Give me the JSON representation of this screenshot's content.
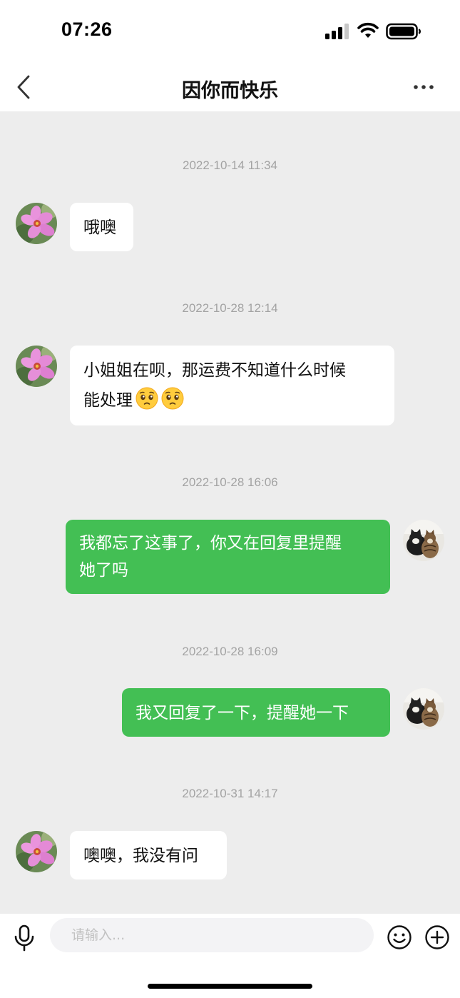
{
  "status_bar": {
    "time": "07:26"
  },
  "header": {
    "title": "因你而快乐"
  },
  "messages": [
    {
      "timestamp": "2022-10-14 11:34",
      "sender": "contact",
      "text": "哦噢"
    },
    {
      "timestamp": "2022-10-28 12:14",
      "sender": "contact",
      "text_line1": "小姐姐在呗，那运费不知道什么时候",
      "text_line2": "能处理",
      "emojis": [
        "pleading-face",
        "pleading-face"
      ]
    },
    {
      "timestamp": "2022-10-28 16:06",
      "sender": "me",
      "text_line1": "我都忘了这事了，你又在回复里提醒",
      "text_line2": "她了吗"
    },
    {
      "timestamp": "2022-10-28 16:09",
      "sender": "me",
      "text": "我又回复了一下，提醒她一下"
    },
    {
      "timestamp": "2022-10-31 14:17",
      "sender": "contact",
      "text": "噢噢，我没有问"
    }
  ],
  "input_bar": {
    "placeholder": "请输入..."
  },
  "icons": {
    "back": "chevron-left-icon",
    "more": "more-dots-icon",
    "voice": "microphone-icon",
    "emoji": "smiley-icon",
    "add": "plus-circle-icon"
  },
  "colors": {
    "outgoing_bubble": "#43bf54",
    "incoming_bubble": "#ffffff",
    "background": "#ededed"
  }
}
